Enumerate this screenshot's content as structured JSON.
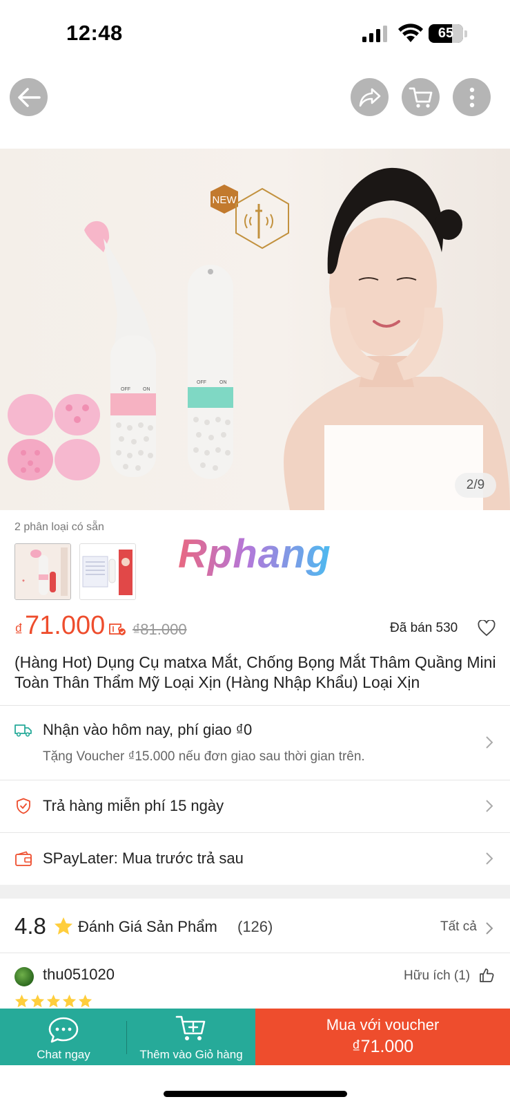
{
  "status_bar": {
    "time": "12:48",
    "battery_level": "65"
  },
  "nav": {
    "back_icon": "arrow-left-icon",
    "share_icon": "share-icon",
    "cart_icon": "cart-icon",
    "more_icon": "more-vertical-icon"
  },
  "gallery": {
    "counter": "2/9",
    "badge_text": "NEW",
    "device_labels": {
      "off": "OFF",
      "on": "ON"
    }
  },
  "variants": {
    "label": "2 phân loại có sẵn",
    "watermark": "Rphang"
  },
  "price": {
    "currency": "₫",
    "value": "71.000",
    "old_price": "₫81.000",
    "sold": "Đã bán 530"
  },
  "product": {
    "title": "(Hàng Hot) Dụng Cụ matxa Mắt, Chống Bọng Mắt Thâm Quầng Mini Toàn Thân Thẩm Mỹ Loại Xịn (Hàng Nhập Khẩu) Loại Xịn"
  },
  "shipping": {
    "title": "Nhận vào hôm nay, phí giao ₫0",
    "subtitle": "Tặng Voucher ₫15.000 nếu đơn giao sau thời gian trên."
  },
  "returns": {
    "title": "Trả hàng miễn phí 15 ngày"
  },
  "paylater": {
    "title": "SPayLater: Mua trước trả sau"
  },
  "reviews": {
    "rating": "4.8",
    "title": "Đánh Giá Sản Phẩm",
    "count": "(126)",
    "see_all": "Tất cả",
    "first_review": {
      "username": "thu051020",
      "helpful": "Hữu ích (1)",
      "stars": 5
    }
  },
  "bottom_bar": {
    "chat_label": "Chat ngay",
    "cart_label": "Thêm vào Giỏ hàng",
    "buy_line1": "Mua với voucher",
    "buy_line2": "₫71.000"
  },
  "colors": {
    "brand_orange": "#ee4d2d",
    "teal": "#26aa99",
    "star": "#ffce3d"
  }
}
